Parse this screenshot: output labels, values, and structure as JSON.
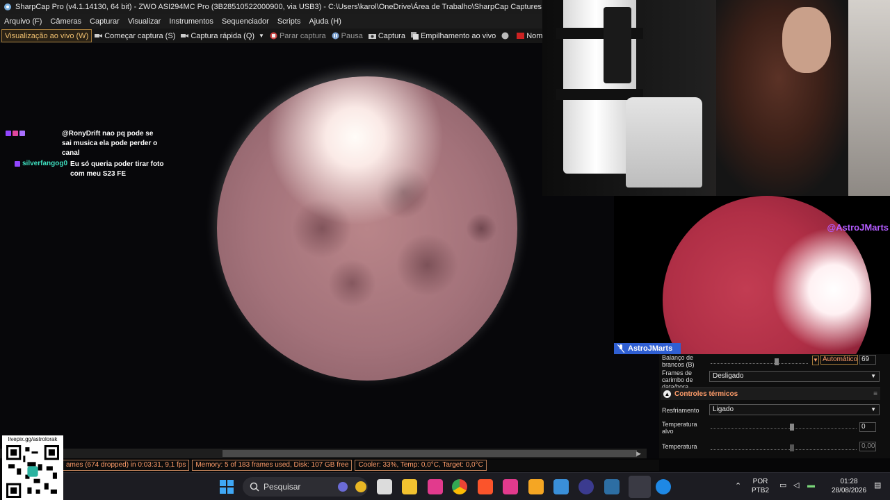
{
  "window": {
    "title": "SharpCap Pro (v4.1.14130, 64 bit) - ZWO ASI294MC Pro (3B28510522000900, via USB3) - C:\\Users\\karol\\OneDrive\\Área de Trabalho\\SharpCap Captures"
  },
  "menu": {
    "items": [
      "Arquivo (F)",
      "Câmeras",
      "Capturar",
      "Visualizar",
      "Instrumentos",
      "Sequenciador",
      "Scripts",
      "Ajuda (H)"
    ]
  },
  "toolbar": {
    "live_view": "Visualização ao vivo (W)",
    "start_capture": "Começar captura (S)",
    "quick_capture": "Captura rápida (Q)",
    "stop_capture": "Parar captura",
    "pause": "Pausa",
    "snapshot": "Captura",
    "live_stack": "Empilhamento ao vivo",
    "target_name": "Nome de destino"
  },
  "chat": {
    "messages": [
      {
        "user": "",
        "text": "@RonyDrift nao pq pode se sai musica ela pode perder o canal",
        "user_color": "#2b40ff"
      },
      {
        "user": "silverfangog0",
        "text": "Eu só queria poder tirar foto com meu S23 FE",
        "user_color": "#3fe0c0"
      }
    ]
  },
  "status": {
    "frames": "ames (674 dropped) in 0:03:31, 9,1 fps",
    "memory": "Memory: 5 of 183 frames used, Disk: 107 GB free",
    "cooler": "Cooler: 33%, Temp: 0,0°C, Target: 0,0°C"
  },
  "overlay": {
    "handle": "@AstroJMarts",
    "nameplate": "AstroJMarts"
  },
  "panel": {
    "white_balance_label": "Balanço de brancos (B)",
    "white_balance_mode": "Automático",
    "white_balance_value": "69",
    "timestamp_label": "Frames de carimbo de data/hora",
    "timestamp_value": "Desligado",
    "thermal_section": "Controles térmicos",
    "cooling_label": "Resfriamento",
    "cooling_value": "Ligado",
    "target_temp_label": "Temperatura alvo",
    "target_temp_value": "0",
    "temperature_label": "Temperatura",
    "temperature_value": "0,00"
  },
  "qr": {
    "url": "livepix.gg/astrolorak"
  },
  "taskbar": {
    "search_placeholder": "Pesquisar",
    "language": "POR",
    "keyboard": "PTB2",
    "time": "01:28",
    "date": "28/08/2026"
  },
  "colors": {
    "accent": "#ff9d6a",
    "twitch_purple": "#b45cff",
    "nameplate_blue": "#2f5fd3"
  }
}
